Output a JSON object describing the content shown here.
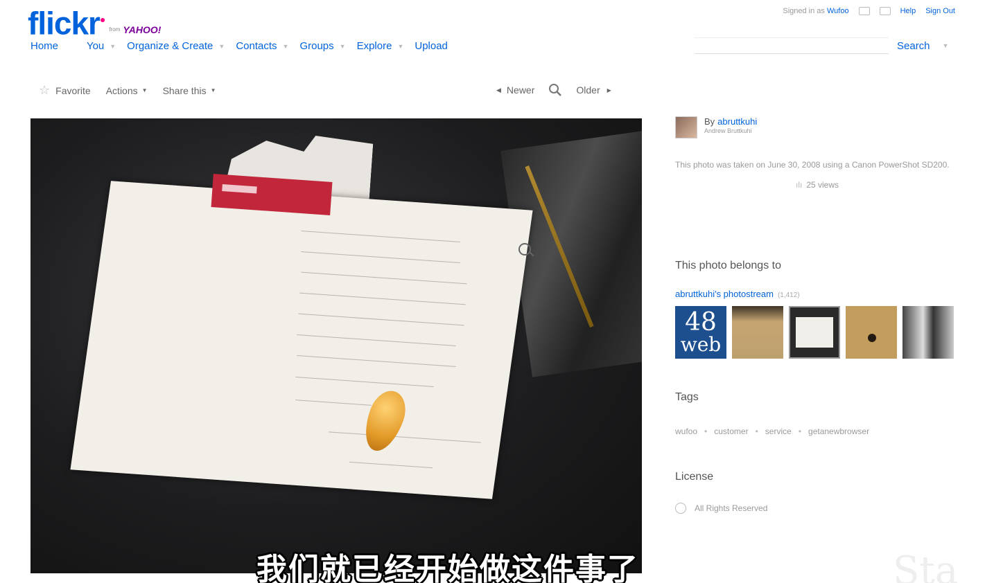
{
  "brand": {
    "name_main": "flick",
    "name_r": "r",
    "from_label": "from",
    "yahoo": "YAHOO!"
  },
  "userbar": {
    "signed_in_label": "Signed in as",
    "username": "Wufoo",
    "help": "Help",
    "sign_out": "Sign Out"
  },
  "nav": {
    "items": [
      {
        "label": "Home"
      },
      {
        "label": "You"
      },
      {
        "label": "Organize & Create"
      },
      {
        "label": "Contacts"
      },
      {
        "label": "Groups"
      },
      {
        "label": "Explore"
      },
      {
        "label": "Upload"
      }
    ]
  },
  "search": {
    "value": "",
    "placeholder": "",
    "button_label": "Search"
  },
  "photo_toolbar": {
    "favorite": "Favorite",
    "actions": "Actions",
    "share": "Share this",
    "newer": "Newer",
    "older": "Older"
  },
  "owner": {
    "by_label": "By",
    "username": "abruttkuhi",
    "real_name": "Andrew Bruttkuhi",
    "taken_text": "This photo was taken on June 30, 2008 using a Canon PowerShot SD200.",
    "views": "25 views"
  },
  "belongs": {
    "heading": "This photo belongs to",
    "stream": "abruttkuhi's photostream",
    "count": "(1,412)",
    "first_thumb_line1": "48",
    "first_thumb_line2": "web"
  },
  "tags": {
    "heading": "Tags",
    "items": [
      "wufoo",
      "customer",
      "service",
      "getanewbrowser"
    ]
  },
  "license": {
    "heading": "License",
    "text": "All Rights Reserved"
  },
  "subtitle": "我们就已经开始做这件事了",
  "watermark": "Sta"
}
